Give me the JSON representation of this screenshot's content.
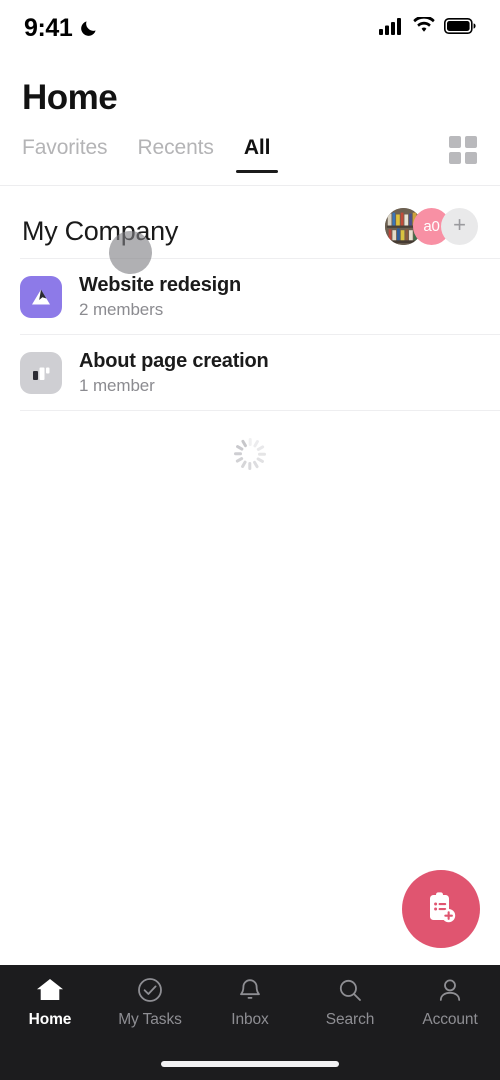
{
  "status_bar": {
    "time": "9:41",
    "dnd_icon": "moon-icon",
    "cellular_icon": "cellular-signal-icon",
    "wifi_icon": "wifi-icon",
    "battery_icon": "battery-full-icon"
  },
  "header": {
    "title": "Home",
    "grid_toggle_icon": "grid-view-icon"
  },
  "tabs": [
    {
      "label": "Favorites",
      "active": false
    },
    {
      "label": "Recents",
      "active": false
    },
    {
      "label": "All",
      "active": true
    }
  ],
  "company": {
    "name": "My Company",
    "members": [
      {
        "type": "photo",
        "name": "member-avatar-photo",
        "label": ""
      },
      {
        "type": "initials",
        "name": "member-avatar-initials",
        "label": "a0",
        "color": "#f890a4"
      },
      {
        "type": "add",
        "name": "add-member-button",
        "label": "+",
        "color": "#e9e9ea"
      }
    ]
  },
  "projects": [
    {
      "title": "Website redesign",
      "members_text": "2 members",
      "icon": "mountain-image-icon",
      "icon_color": "#8d7ae8"
    },
    {
      "title": "About page creation",
      "members_text": "1 member",
      "icon": "kanban-board-icon",
      "icon_color": "#cfcfd3"
    }
  ],
  "loading": {
    "spinner_icon": "loading-spinner-icon"
  },
  "fab": {
    "icon": "create-task-icon",
    "label": "",
    "color": "#e05570"
  },
  "bottom_nav": [
    {
      "label": "Home",
      "icon": "home-icon",
      "active": true
    },
    {
      "label": "My Tasks",
      "icon": "check-circle-icon",
      "active": false
    },
    {
      "label": "Inbox",
      "icon": "bell-icon",
      "active": false
    },
    {
      "label": "Search",
      "icon": "search-icon",
      "active": false
    },
    {
      "label": "Account",
      "icon": "person-icon",
      "active": false
    }
  ],
  "system": {
    "home_indicator": "home-indicator"
  }
}
